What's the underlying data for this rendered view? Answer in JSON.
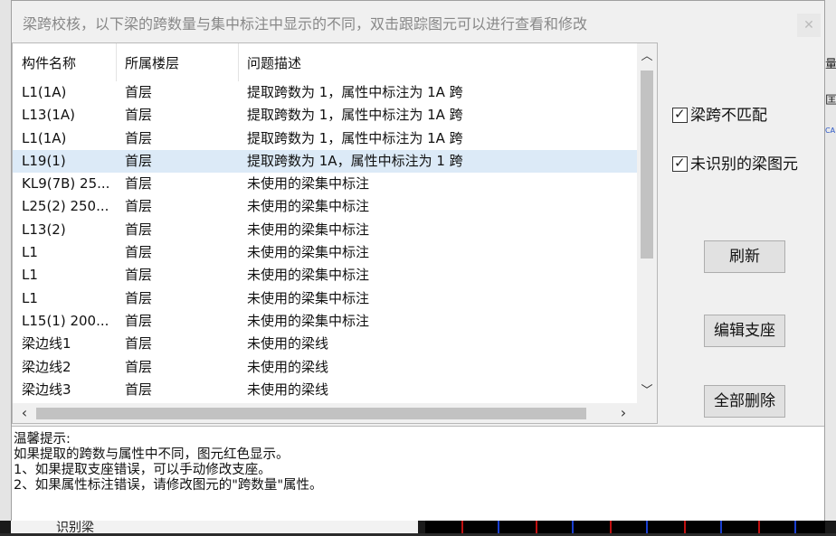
{
  "dialog": {
    "title": "梁跨校核，以下梁的跨数量与集中标注中显示的不同，双击跟踪图元可以进行查看和修改",
    "close_icon": "close-icon"
  },
  "table": {
    "columns": [
      "构件名称",
      "所属楼层",
      "问题描述"
    ],
    "rows": [
      {
        "name": "L1(1A)",
        "floor": "首层",
        "desc": "提取跨数为 1，属性中标注为 1A 跨",
        "selected": false
      },
      {
        "name": "L13(1A)",
        "floor": "首层",
        "desc": "提取跨数为 1，属性中标注为 1A 跨",
        "selected": false
      },
      {
        "name": "L1(1A)",
        "floor": "首层",
        "desc": "提取跨数为 1，属性中标注为 1A 跨",
        "selected": false
      },
      {
        "name": "L19(1)",
        "floor": "首层",
        "desc": "提取跨数为 1A，属性中标注为 1 跨",
        "selected": true
      },
      {
        "name": "KL9(7B) 25...",
        "floor": "首层",
        "desc": "未使用的梁集中标注",
        "selected": false
      },
      {
        "name": "L25(2) 250...",
        "floor": "首层",
        "desc": "未使用的梁集中标注",
        "selected": false
      },
      {
        "name": "L13(2)",
        "floor": "首层",
        "desc": "未使用的梁集中标注",
        "selected": false
      },
      {
        "name": "L1",
        "floor": "首层",
        "desc": "未使用的梁集中标注",
        "selected": false
      },
      {
        "name": "L1",
        "floor": "首层",
        "desc": "未使用的梁集中标注",
        "selected": false
      },
      {
        "name": "L1",
        "floor": "首层",
        "desc": "未使用的梁集中标注",
        "selected": false
      },
      {
        "name": "L15(1) 200...",
        "floor": "首层",
        "desc": "未使用的梁集中标注",
        "selected": false
      },
      {
        "name": "梁边线1",
        "floor": "首层",
        "desc": "未使用的梁线",
        "selected": false
      },
      {
        "name": "梁边线2",
        "floor": "首层",
        "desc": "未使用的梁线",
        "selected": false
      },
      {
        "name": "梁边线3",
        "floor": "首层",
        "desc": "未使用的梁线",
        "selected": false
      }
    ]
  },
  "scrollbars": {
    "up_icon": "chevron-up-icon",
    "down_icon": "chevron-down-icon",
    "left_icon": "chevron-left-icon",
    "right_icon": "chevron-right-icon"
  },
  "options": {
    "span_mismatch": {
      "label": "梁跨不匹配",
      "checked": true
    },
    "unrecognized": {
      "label": "未识别的梁图元",
      "checked": true
    }
  },
  "buttons": {
    "refresh": "刷新",
    "edit_support": "编辑支座",
    "delete_all": "全部删除"
  },
  "tips": {
    "title": "温馨提示:",
    "lines": [
      "如果提取的跨数与属性中不同，图元红色显示。",
      "1、如果提取支座错误，可以手动修改支座。",
      "2、如果属性标注错误，请修改图元的\"跨数量\"属性。"
    ]
  },
  "background": {
    "tree_item": "识别梁",
    "right_fragments": [
      "量",
      "匡",
      "CA"
    ]
  }
}
